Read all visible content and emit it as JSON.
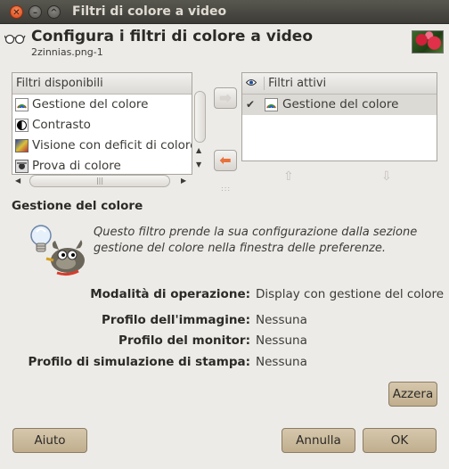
{
  "window": {
    "title": "Filtri di colore a video"
  },
  "header": {
    "title": "Configura i filtri di colore a video",
    "subtitle": "2zinnias.png-1"
  },
  "available": {
    "heading": "Filtri disponibili",
    "items": [
      {
        "label": "Gestione del colore",
        "icon": "color-management-icon"
      },
      {
        "label": "Contrasto",
        "icon": "contrast-icon"
      },
      {
        "label": "Visione con deficit di colore",
        "icon": "color-deficit-icon"
      },
      {
        "label": "Prova di colore",
        "icon": "color-proof-icon"
      }
    ]
  },
  "active": {
    "heading": "Filtri attivi",
    "items": [
      {
        "label": "Gestione del colore",
        "checked": true,
        "icon": "color-management-icon"
      }
    ]
  },
  "details": {
    "title": "Gestione del colore",
    "description": "Questo filtro prende la sua configurazione dalla sezione gestione del colore nella finestra delle preferenze.",
    "properties": [
      {
        "key": "Modalità di operazione:",
        "value": "Display con gestione del colore"
      },
      {
        "key": "Profilo dell'immagine:",
        "value": "Nessuna"
      },
      {
        "key": "Profilo del monitor:",
        "value": "Nessuna"
      },
      {
        "key": "Profilo di simulazione di stampa:",
        "value": "Nessuna"
      }
    ],
    "reset_label": "Azzera"
  },
  "buttons": {
    "help": "Aiuto",
    "cancel": "Annulla",
    "ok": "OK"
  },
  "colors": {
    "accent": "#e9713a",
    "titlebar": "#3c3b37",
    "selection": "#dcdad5"
  }
}
